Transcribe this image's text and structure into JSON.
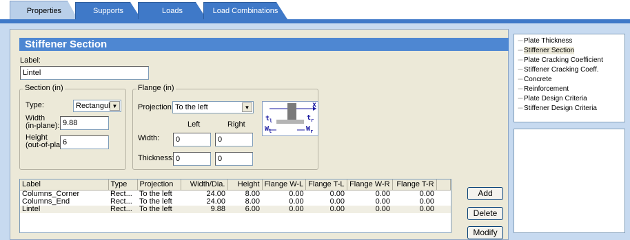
{
  "tabs": [
    {
      "label": "Properties"
    },
    {
      "label": "Supports"
    },
    {
      "label": "Loads"
    },
    {
      "label": "Load Combinations"
    }
  ],
  "section_title": "Stiffener Section",
  "label_field": {
    "label": "Label:",
    "value": "Lintel"
  },
  "section_group": {
    "title": "Section (in)",
    "type_label": "Type:",
    "type_value": "Rectangular",
    "width_label_1": "Width",
    "width_label_2": "(in-plane):",
    "width_value": "9.88",
    "height_label_1": "Height",
    "height_label_2": "(out-of-plane):",
    "height_value": "6"
  },
  "flange_group": {
    "title": "Flange (in)",
    "projection_label": "Projection:",
    "projection_value": "To the left",
    "left_header": "Left",
    "right_header": "Right",
    "width_label": "Width:",
    "thickness_label": "Thickness:",
    "width_left": "0",
    "width_right": "0",
    "thickness_left": "0",
    "thickness_right": "0"
  },
  "diagram": {
    "x": "x",
    "tl": "t",
    "tl_sub": "l",
    "tr": "t",
    "tr_sub": "r",
    "wl": "W",
    "wl_sub": "l",
    "wr": "W",
    "wr_sub": "r"
  },
  "table": {
    "headers": [
      "Label",
      "Type",
      "Projection",
      "Width/Dia.",
      "Height",
      "Flange W-L",
      "Flange T-L",
      "Flange W-R",
      "Flange T-R"
    ],
    "rows": [
      [
        "Columns_Corner",
        "Rect...",
        "To the left",
        "24.00",
        "8.00",
        "0.00",
        "0.00",
        "0.00",
        "0.00"
      ],
      [
        "Columns_End",
        "Rect...",
        "To the left",
        "24.00",
        "8.00",
        "0.00",
        "0.00",
        "0.00",
        "0.00"
      ],
      [
        "Lintel",
        "Rect...",
        "To the left",
        "9.88",
        "6.00",
        "0.00",
        "0.00",
        "0.00",
        "0.00"
      ]
    ]
  },
  "buttons": {
    "add": "Add",
    "delete": "Delete",
    "modify": "Modify"
  },
  "tree": [
    "Plate Thickness",
    "Stiffener Section",
    "Plate Cracking Coefficient",
    "Stiffener Cracking Coeff.",
    "Concrete",
    "Reinforcement",
    "Plate Design Criteria",
    "Stiffener Design Criteria"
  ],
  "colors": {
    "tab_blue": "#3f79c8",
    "title_blue": "#4e87d2",
    "panel_bg": "#ece9d8",
    "diagram_blue": "#1a1aa0"
  }
}
